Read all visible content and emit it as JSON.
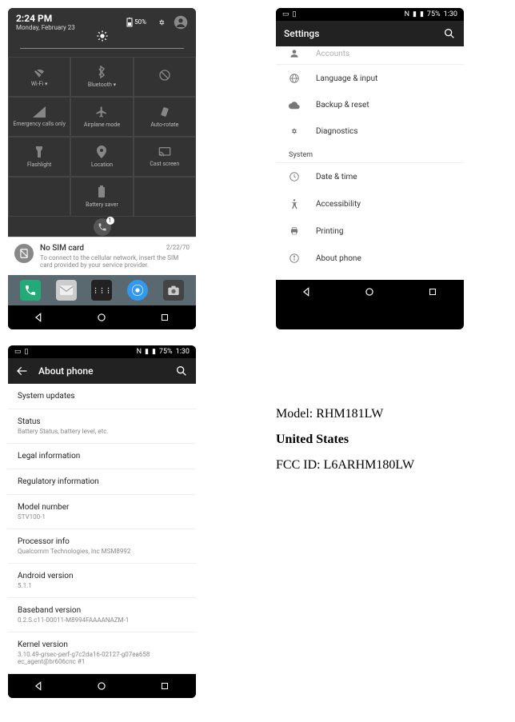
{
  "screen1": {
    "status": {
      "battery_pct": "50%"
    },
    "time": "2:24 PM",
    "date": "Monday, February 23",
    "tiles": [
      {
        "label": "Wi-Fi",
        "dropdown": true
      },
      {
        "label": "Bluetooth",
        "dropdown": true
      },
      {
        "label": ""
      },
      {
        "label": "Emergency calls only"
      },
      {
        "label": "Airplane mode"
      },
      {
        "label": "Auto-rotate"
      },
      {
        "label": "Flashlight"
      },
      {
        "label": "Location"
      },
      {
        "label": "Cast screen"
      },
      {
        "label": ""
      },
      {
        "label": "Battery saver"
      },
      {
        "label": ""
      }
    ],
    "notif": {
      "title": "No SIM card",
      "time": "2/22/70",
      "body": "To connect to the cellular network, insert the SIM card provided by your service provider."
    }
  },
  "screen2": {
    "status": {
      "indicator": "N",
      "battery_pct": "75%",
      "time": "1:30"
    },
    "title": "Settings",
    "partial_item": "Accounts",
    "items_personal": [
      "Language & input",
      "Backup & reset",
      "Diagnostics"
    ],
    "section": "System",
    "items_system": [
      "Date & time",
      "Accessibility",
      "Printing",
      "About phone"
    ]
  },
  "screen3": {
    "status": {
      "indicator": "N",
      "battery_pct": "75%",
      "time": "1:30"
    },
    "title": "About phone",
    "items": [
      {
        "t": "System updates"
      },
      {
        "t": "Status",
        "s": "Battery Status, battery level, etc."
      },
      {
        "t": "Legal information"
      },
      {
        "t": "Regulatory information"
      },
      {
        "t": "Model number",
        "s": "STV100-1"
      },
      {
        "t": "Processor info",
        "s": "Qualcomm Technologies, Inc MSM8992"
      },
      {
        "t": "Android version",
        "s": "5.1.1"
      },
      {
        "t": "Baseband version",
        "s": "0.2.S.c11-00011-M8994FAAAANAZM-1"
      },
      {
        "t": "Kernel version",
        "s": "3.10.49-grsec-perf-g7c2da16-02127-g07ea658\nec_agent@br606cnc #1"
      }
    ]
  },
  "info": {
    "model_label": "Model:",
    "model_value": "RHM181LW",
    "country": "United States",
    "fcc_label": "FCC ID:",
    "fcc_value": "L6ARHM180LW"
  }
}
